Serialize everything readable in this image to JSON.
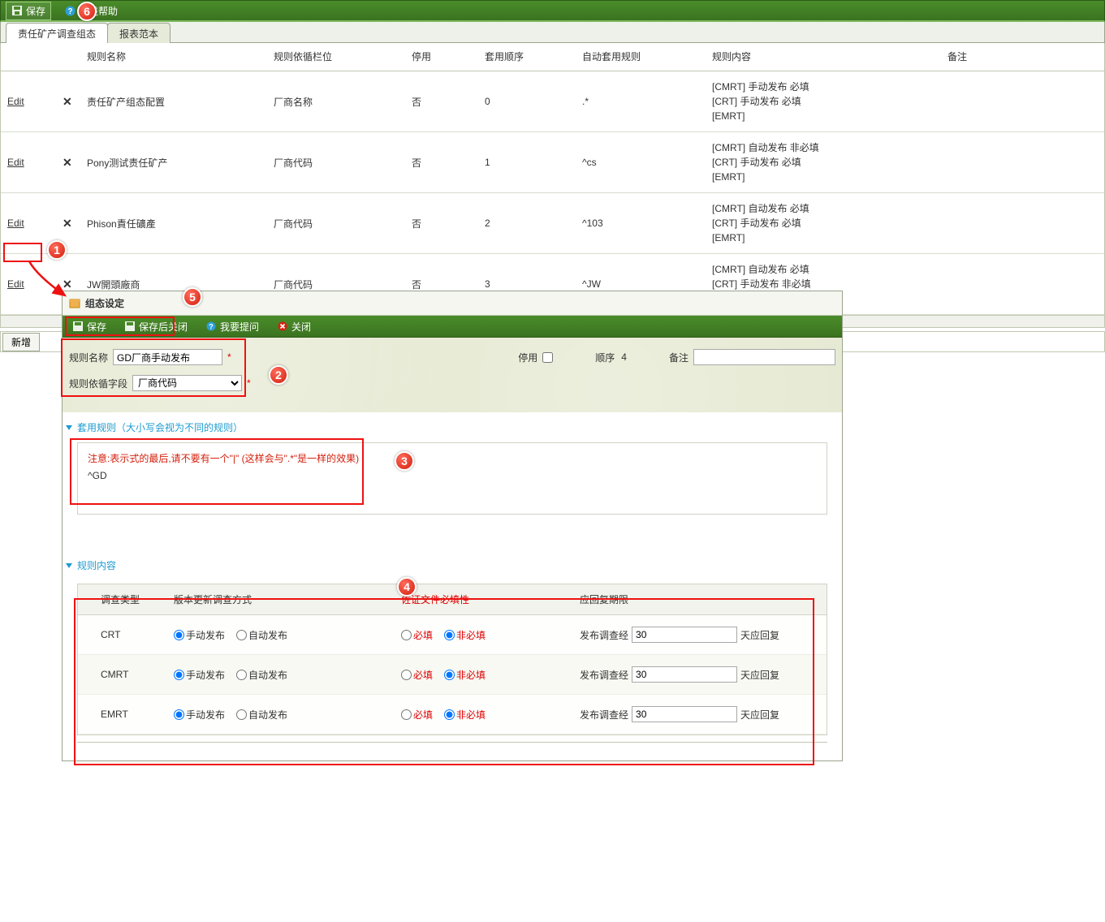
{
  "topToolbar": {
    "save": "保存",
    "help": "在线帮助"
  },
  "tabs": {
    "t1": "责任矿产调查组态",
    "t2": "报表范本"
  },
  "gridHeaders": {
    "name": "规则名称",
    "field": "规则依循栏位",
    "stop": "停用",
    "seq": "套用顺序",
    "auto": "自动套用规则",
    "content": "规则内容",
    "note": "备注"
  },
  "rows": [
    {
      "name": "责任矿产组态配置",
      "field": "厂商名称",
      "stop": "否",
      "seq": "0",
      "auto": ".*",
      "content": "[CMRT] 手动发布 必填\n[CRT] 手动发布 必填\n[EMRT]"
    },
    {
      "name": "Pony测试责任矿产",
      "field": "厂商代码",
      "stop": "否",
      "seq": "1",
      "auto": "^cs",
      "content": "[CMRT] 自动发布 非必填\n[CRT] 手动发布 必填\n[EMRT]"
    },
    {
      "name": "Phison責任礦產",
      "field": "厂商代码",
      "stop": "否",
      "seq": "2",
      "auto": "^103",
      "content": "[CMRT] 自动发布 必填\n[CRT] 手动发布 必填\n[EMRT]"
    },
    {
      "name": "JW開頭廠商",
      "field": "厂商代码",
      "stop": "否",
      "seq": "3",
      "auto": "^JW",
      "content": "[CMRT] 自动发布 必填\n[CRT] 手动发布 非必填\n[EMRT]"
    }
  ],
  "editLabel": "Edit",
  "newBtn": "新增",
  "dialog": {
    "title": "组态设定",
    "tb": {
      "save": "保存",
      "saveClose": "保存后关闭",
      "ask": "我要提问",
      "close": "关闭"
    },
    "form": {
      "ruleNameLbl": "规则名称",
      "ruleNameVal": "GD厂商手动发布",
      "fieldLbl": "规则依循字段",
      "fieldVal": "厂商代码",
      "stopLbl": "停用",
      "seqLbl": "顺序",
      "seqVal": "4",
      "noteLbl": "备注"
    },
    "section1": "套用规则（大小写会视为不同的规则）",
    "warnText": "注意:表示式的最后,请不要有一个\"|\" (这样会与\".*\"是一样的效果)",
    "ruleExpr": "^GD",
    "section2": "规则内容",
    "innerHeaders": {
      "type": "调查类型",
      "method": "版本更新调查方式",
      "req": "佐证文件必填性",
      "deadline": "应回复期限"
    },
    "radioLabels": {
      "manual": "手动发布",
      "auto": "自动发布",
      "required": "必填",
      "optional": "非必填"
    },
    "deadlinePrefix": "发布调查经",
    "deadlineSuffix": "天应回复",
    "innerRows": [
      {
        "type": "CRT",
        "methodSel": "manual",
        "reqSel": "optional",
        "days": "30"
      },
      {
        "type": "CMRT",
        "methodSel": "manual",
        "reqSel": "optional",
        "days": "30"
      },
      {
        "type": "EMRT",
        "methodSel": "manual",
        "reqSel": "optional",
        "days": "30"
      }
    ]
  },
  "callouts": {
    "c1": "1",
    "c2": "2",
    "c3": "3",
    "c4": "4",
    "c5": "5",
    "c6": "6"
  }
}
